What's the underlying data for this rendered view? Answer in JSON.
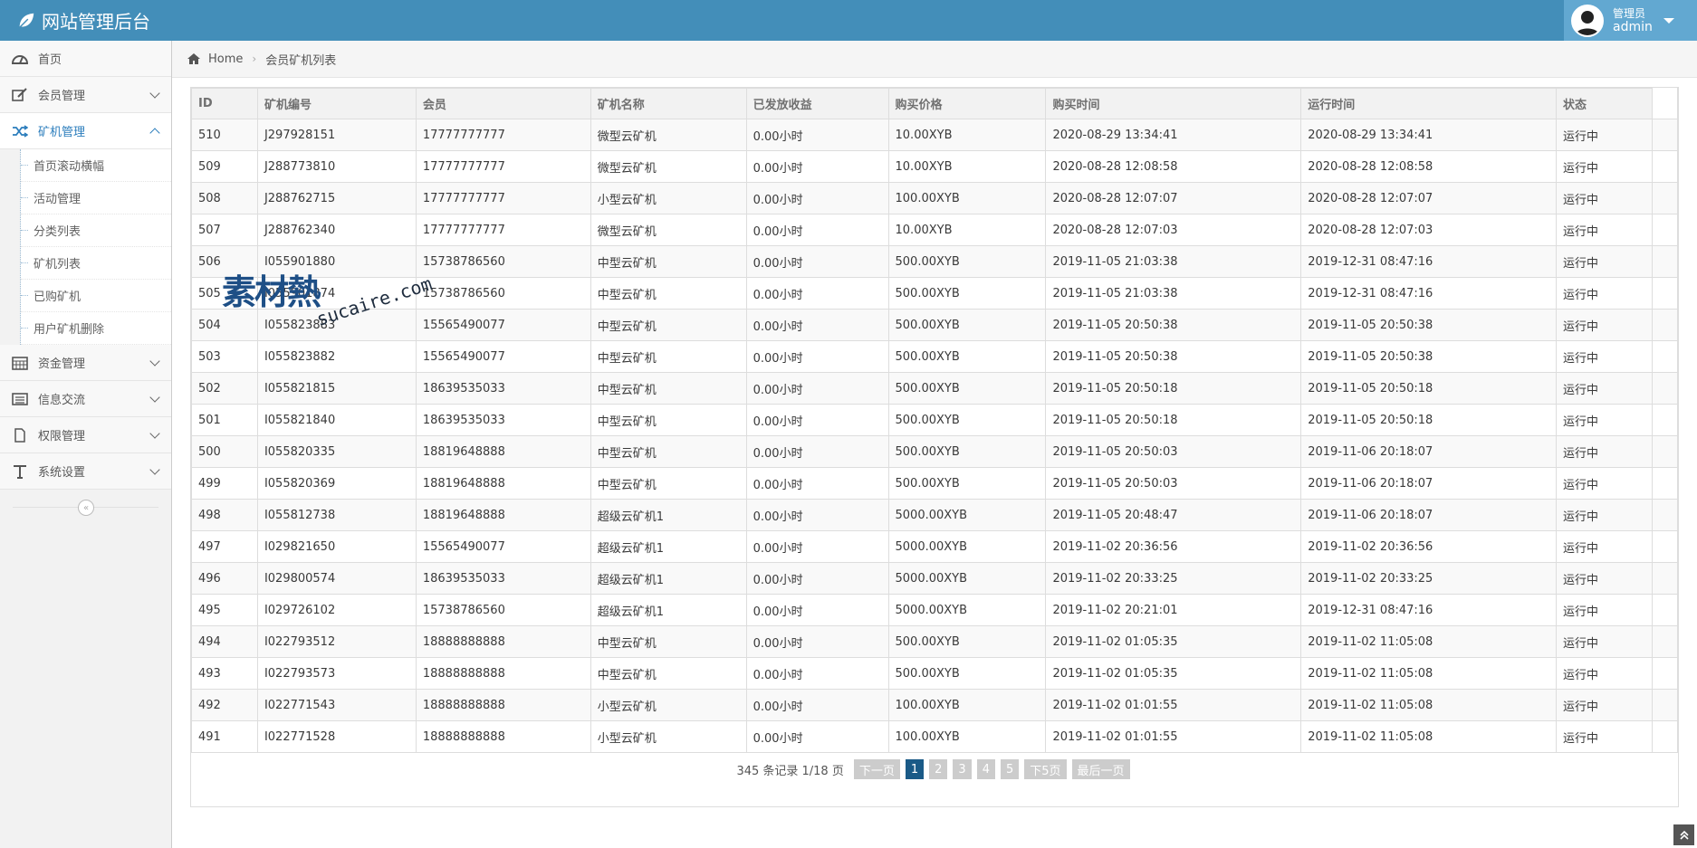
{
  "app": {
    "title": "网站管理后台"
  },
  "user": {
    "welcome": "管理员",
    "name": "admin"
  },
  "sidebar": {
    "items": [
      {
        "label": "首页",
        "icon": "dashboard-icon"
      },
      {
        "label": "会员管理",
        "icon": "edit-icon"
      },
      {
        "label": "矿机管理",
        "icon": "shuffle-icon"
      },
      {
        "label": "资金管理",
        "icon": "calendar-icon"
      },
      {
        "label": "信息交流",
        "icon": "list-icon"
      },
      {
        "label": "权限管理",
        "icon": "file-icon"
      },
      {
        "label": "系统设置",
        "icon": "text-icon"
      }
    ],
    "subitems": [
      "首页滚动横幅",
      "活动管理",
      "分类列表",
      "矿机列表",
      "已购矿机",
      "用户矿机删除"
    ]
  },
  "breadcrumb": {
    "home": "Home",
    "current": "会员矿机列表"
  },
  "table": {
    "headers": [
      "ID",
      "矿机编号",
      "会员",
      "矿机名称",
      "已发放收益",
      "购买价格",
      "购买时间",
      "运行时间",
      "状态"
    ],
    "rows": [
      [
        "510",
        "J297928151",
        "17777777777",
        "微型云矿机",
        "0.00小时",
        "10.00XYB",
        "2020-08-29 13:34:41",
        "2020-08-29 13:34:41",
        "运行中"
      ],
      [
        "509",
        "J288773810",
        "17777777777",
        "微型云矿机",
        "0.00小时",
        "10.00XYB",
        "2020-08-28 12:08:58",
        "2020-08-28 12:08:58",
        "运行中"
      ],
      [
        "508",
        "J288762715",
        "17777777777",
        "小型云矿机",
        "0.00小时",
        "100.00XYB",
        "2020-08-28 12:07:07",
        "2020-08-28 12:07:07",
        "运行中"
      ],
      [
        "507",
        "J288762340",
        "17777777777",
        "微型云矿机",
        "0.00小时",
        "10.00XYB",
        "2020-08-28 12:07:03",
        "2020-08-28 12:07:03",
        "运行中"
      ],
      [
        "506",
        "I055901880",
        "15738786560",
        "中型云矿机",
        "0.00小时",
        "500.00XYB",
        "2019-11-05 21:03:38",
        "2019-12-31 08:47:16",
        "运行中"
      ],
      [
        "505",
        "I055901874",
        "15738786560",
        "中型云矿机",
        "0.00小时",
        "500.00XYB",
        "2019-11-05 21:03:38",
        "2019-12-31 08:47:16",
        "运行中"
      ],
      [
        "504",
        "I055823883",
        "15565490077",
        "中型云矿机",
        "0.00小时",
        "500.00XYB",
        "2019-11-05 20:50:38",
        "2019-11-05 20:50:38",
        "运行中"
      ],
      [
        "503",
        "I055823882",
        "15565490077",
        "中型云矿机",
        "0.00小时",
        "500.00XYB",
        "2019-11-05 20:50:38",
        "2019-11-05 20:50:38",
        "运行中"
      ],
      [
        "502",
        "I055821815",
        "18639535033",
        "中型云矿机",
        "0.00小时",
        "500.00XYB",
        "2019-11-05 20:50:18",
        "2019-11-05 20:50:18",
        "运行中"
      ],
      [
        "501",
        "I055821840",
        "18639535033",
        "中型云矿机",
        "0.00小时",
        "500.00XYB",
        "2019-11-05 20:50:18",
        "2019-11-05 20:50:18",
        "运行中"
      ],
      [
        "500",
        "I055820335",
        "18819648888",
        "中型云矿机",
        "0.00小时",
        "500.00XYB",
        "2019-11-05 20:50:03",
        "2019-11-06 20:18:07",
        "运行中"
      ],
      [
        "499",
        "I055820369",
        "18819648888",
        "中型云矿机",
        "0.00小时",
        "500.00XYB",
        "2019-11-05 20:50:03",
        "2019-11-06 20:18:07",
        "运行中"
      ],
      [
        "498",
        "I055812738",
        "18819648888",
        "超级云矿机1",
        "0.00小时",
        "5000.00XYB",
        "2019-11-05 20:48:47",
        "2019-11-06 20:18:07",
        "运行中"
      ],
      [
        "497",
        "I029821650",
        "15565490077",
        "超级云矿机1",
        "0.00小时",
        "5000.00XYB",
        "2019-11-02 20:36:56",
        "2019-11-02 20:36:56",
        "运行中"
      ],
      [
        "496",
        "I029800574",
        "18639535033",
        "超级云矿机1",
        "0.00小时",
        "5000.00XYB",
        "2019-11-02 20:33:25",
        "2019-11-02 20:33:25",
        "运行中"
      ],
      [
        "495",
        "I029726102",
        "15738786560",
        "超级云矿机1",
        "0.00小时",
        "5000.00XYB",
        "2019-11-02 20:21:01",
        "2019-12-31 08:47:16",
        "运行中"
      ],
      [
        "494",
        "I022793512",
        "18888888888",
        "中型云矿机",
        "0.00小时",
        "500.00XYB",
        "2019-11-02 01:05:35",
        "2019-11-02 11:05:08",
        "运行中"
      ],
      [
        "493",
        "I022793573",
        "18888888888",
        "中型云矿机",
        "0.00小时",
        "500.00XYB",
        "2019-11-02 01:05:35",
        "2019-11-02 11:05:08",
        "运行中"
      ],
      [
        "492",
        "I022771543",
        "18888888888",
        "小型云矿机",
        "0.00小时",
        "100.00XYB",
        "2019-11-02 01:01:55",
        "2019-11-02 11:05:08",
        "运行中"
      ],
      [
        "491",
        "I022771528",
        "18888888888",
        "小型云矿机",
        "0.00小时",
        "100.00XYB",
        "2019-11-02 01:01:55",
        "2019-11-02 11:05:08",
        "运行中"
      ]
    ]
  },
  "pagination": {
    "info": "345 条记录 1/18 页",
    "next": "下一页",
    "pages": [
      "1",
      "2",
      "3",
      "4",
      "5"
    ],
    "next5": "下5页",
    "last": "最后一页"
  },
  "watermark": {
    "big": "素材熱",
    "small": "sucaire.com"
  },
  "colors": {
    "navbar": "#438eb9",
    "user_box": "#62a8d1",
    "active_page": "#1a5a87",
    "active_nav": "#2b7dbc"
  }
}
